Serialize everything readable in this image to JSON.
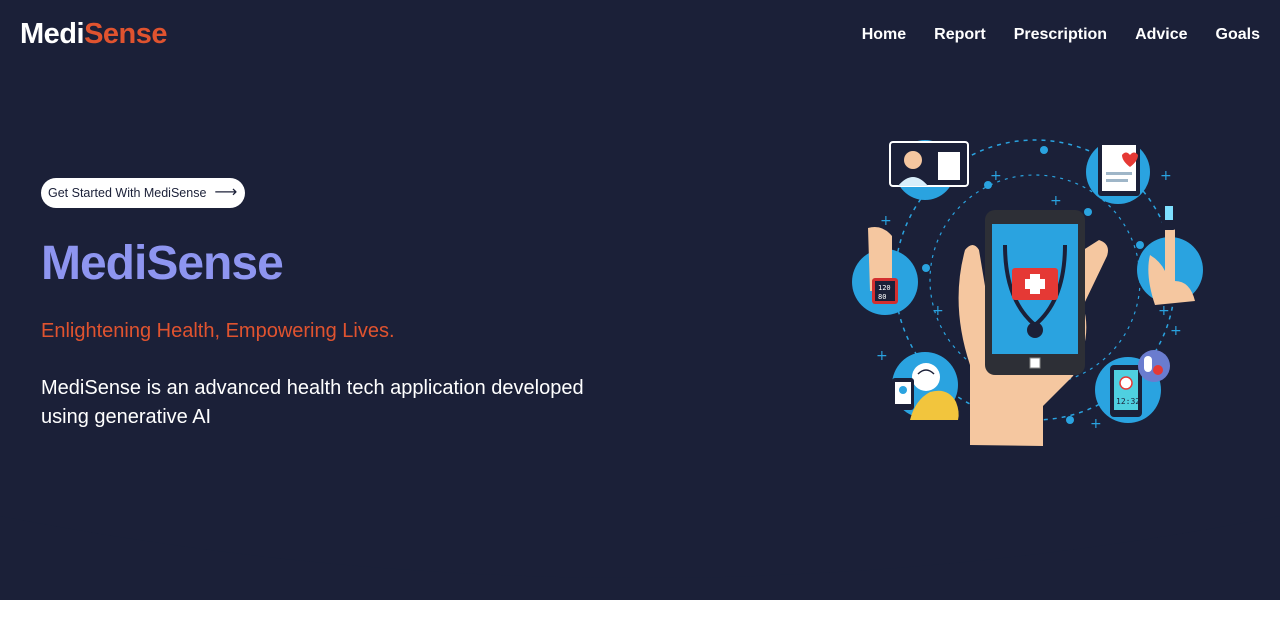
{
  "brand": {
    "part1": "Medi",
    "part2": "Sense"
  },
  "nav": {
    "items": [
      {
        "label": "Home"
      },
      {
        "label": "Report"
      },
      {
        "label": "Prescription"
      },
      {
        "label": "Advice"
      },
      {
        "label": "Goals"
      }
    ]
  },
  "hero": {
    "cta_label": "Get Started With MediSense",
    "cta_arrow": "⟶",
    "title": "MediSense",
    "tagline": "Enlightening Health, Empowering Lives.",
    "description": "MediSense is an advanced health tech application developed using generative AI"
  },
  "colors": {
    "background": "#1b2038",
    "accent_orange": "#e0532f",
    "title_purple": "#8e95f0",
    "illustration_blue": "#2aa3e0"
  },
  "illustration": {
    "icons": [
      "doctor-icon",
      "health-report-icon",
      "smartwatch-icon",
      "pulse-oximeter-icon",
      "brain-icon",
      "pill-reminder-icon",
      "smartphone-first-aid-icon"
    ],
    "watch_readout": [
      "120",
      "80"
    ],
    "phone_clock": "12:32"
  }
}
